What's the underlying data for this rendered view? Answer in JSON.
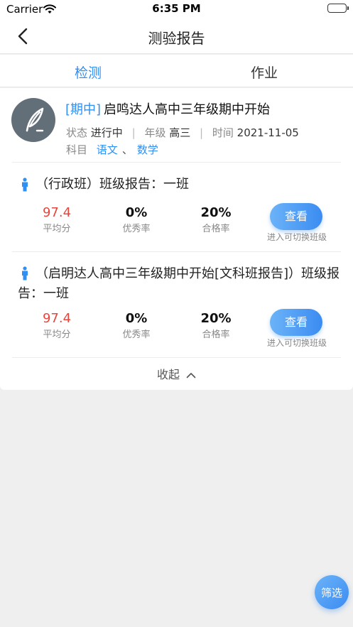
{
  "status_bar": {
    "carrier": "Carrier",
    "time": "6:35 PM"
  },
  "nav": {
    "title": "测验报告"
  },
  "tabs": [
    {
      "label": "检测",
      "active": true
    },
    {
      "label": "作业",
      "active": false
    }
  ],
  "exam": {
    "tag": "[期中]",
    "title": "启鸣达人高中三年级期中开始",
    "status_key": "状态",
    "status_value": "进行中",
    "grade_key": "年级",
    "grade_value": "高三",
    "time_key": "时间",
    "time_value": "2021-11-05",
    "subject_key": "科目",
    "subjects": [
      "语文",
      "数学"
    ],
    "subject_sep": "、"
  },
  "reports": [
    {
      "title": "（行政班）班级报告：一班",
      "stats": [
        {
          "value": "97.4",
          "label": "平均分"
        },
        {
          "value": "0%",
          "label": "优秀率"
        },
        {
          "value": "20%",
          "label": "合格率"
        }
      ],
      "button": "查看",
      "hint": "进入可切换班级"
    },
    {
      "title": "（启明达人高中三年级期中开始[文科班报告]）班级报告：一班",
      "stats": [
        {
          "value": "97.4",
          "label": "平均分"
        },
        {
          "value": "0%",
          "label": "优秀率"
        },
        {
          "value": "20%",
          "label": "合格率"
        }
      ],
      "button": "查看",
      "hint": "进入可切换班级"
    }
  ],
  "collapse_label": "收起",
  "filter_label": "筛选",
  "colors": {
    "accent": "#2f8ff5",
    "score_red": "#e8453c"
  }
}
